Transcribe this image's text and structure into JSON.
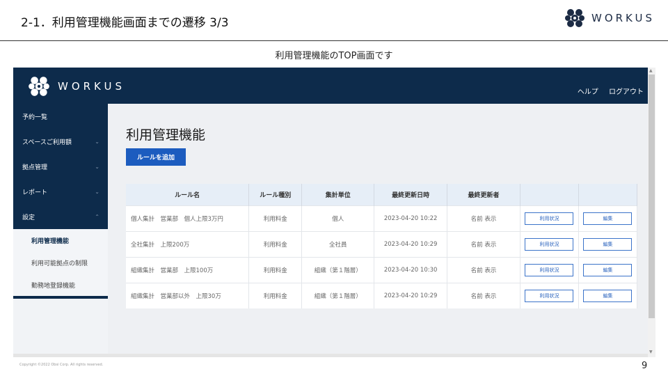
{
  "slide": {
    "title": "2-1．利用管理機能画面までの遷移 3/3",
    "logo_text": "WORKUS",
    "subtitle": "利用管理機能のTOP画面です",
    "copyright": "Copyright ©2022 Obsi Corp. All rights reserved.",
    "page_number": "9"
  },
  "app": {
    "logo_text": "WORKUS",
    "header_links": {
      "help": "ヘルプ",
      "logout": "ログアウト"
    },
    "sidebar": {
      "items": [
        {
          "label": "予約一覧",
          "chevron": ""
        },
        {
          "label": "スペースご利用額",
          "chevron": "chevron-down-icon"
        },
        {
          "label": "拠点管理",
          "chevron": "chevron-down-icon"
        },
        {
          "label": "レポート",
          "chevron": "chevron-down-icon"
        },
        {
          "label": "設定",
          "chevron": "chevron-up-icon"
        }
      ],
      "sub_items": [
        {
          "label": "利用管理機能",
          "active": true
        },
        {
          "label": "利用可能拠点の制限",
          "active": false
        },
        {
          "label": "勤務地登録機能",
          "active": false
        }
      ]
    },
    "main": {
      "heading": "利用管理機能",
      "add_button": "ルールを追加",
      "table": {
        "headers": [
          "ルール名",
          "ルール種別",
          "集計単位",
          "最終更新日時",
          "最終更新者",
          "",
          ""
        ],
        "rows": [
          {
            "name": "個人集計　営業部　個人上限3万円",
            "type": "利用料金",
            "unit": "個人",
            "updated": "2023-04-20 10:22",
            "author": "名前 表示",
            "status_btn": "利用状況",
            "edit_btn": "編集"
          },
          {
            "name": "全社集計　上限200万",
            "type": "利用料金",
            "unit": "全社員",
            "updated": "2023-04-20 10:29",
            "author": "名前 表示",
            "status_btn": "利用状況",
            "edit_btn": "編集"
          },
          {
            "name": "組織集計　営業部　上限100万",
            "type": "利用料金",
            "unit": "組織（第１階層）",
            "updated": "2023-04-20 10:30",
            "author": "名前 表示",
            "status_btn": "利用状況",
            "edit_btn": "編集"
          },
          {
            "name": "組織集計　営業部以外　上限30万",
            "type": "利用料金",
            "unit": "組織（第１階層）",
            "updated": "2023-04-20 10:29",
            "author": "名前 表示",
            "status_btn": "利用状況",
            "edit_btn": "編集"
          }
        ]
      }
    }
  },
  "colors": {
    "navy": "#0d2b4b",
    "button_blue": "#1c5cbf",
    "header_row": "#e6eef7"
  }
}
